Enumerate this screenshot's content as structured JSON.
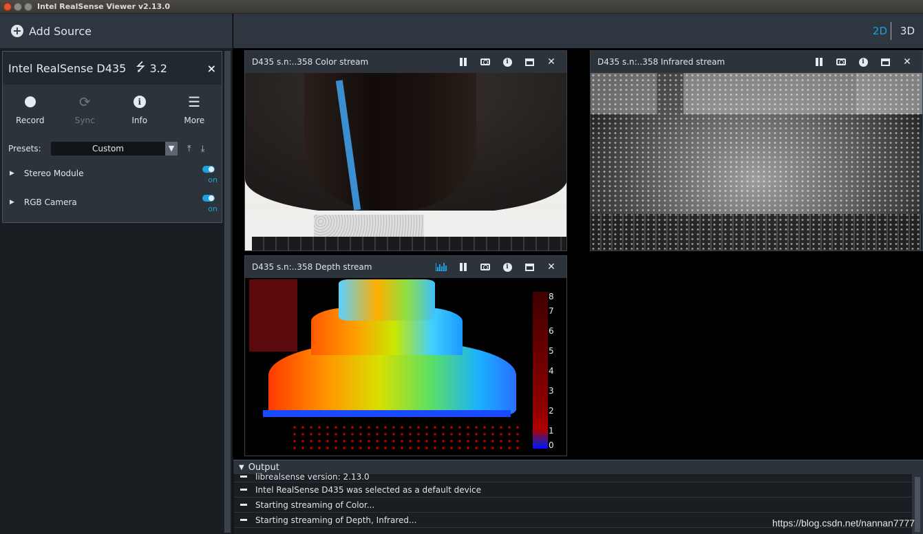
{
  "window": {
    "title": "Intel RealSense Viewer v2.13.0"
  },
  "left": {
    "add_source": "Add Source",
    "device": {
      "name": "Intel RealSense D435",
      "usb_icon": "usb-icon",
      "usb_version": "3.2",
      "close": "×",
      "toolbar": [
        {
          "label": "Record",
          "icon": "record-icon",
          "enabled": true
        },
        {
          "label": "Sync",
          "icon": "sync-icon",
          "enabled": false
        },
        {
          "label": "Info",
          "icon": "info-icon",
          "enabled": true
        },
        {
          "label": "More",
          "icon": "hamburger-icon",
          "enabled": true
        }
      ],
      "presets_label": "Presets:",
      "preset_value": "Custom",
      "sensors": [
        {
          "name": "Stereo Module",
          "state": "on"
        },
        {
          "name": "RGB Camera",
          "state": "on"
        }
      ]
    }
  },
  "view_modes": {
    "mode_2d": "2D",
    "mode_3d": "3D",
    "active": "2D"
  },
  "streams": {
    "color": {
      "title": "D435 s.n:..358 Color stream"
    },
    "infrared": {
      "title": "D435 s.n:..358 Infrared stream"
    },
    "depth": {
      "title": "D435 s.n:..358 Depth stream",
      "scale_ticks": [
        "8",
        "7",
        "6",
        "5",
        "4",
        "3",
        "2",
        "1",
        "0"
      ]
    }
  },
  "output": {
    "label": "Output",
    "lines": [
      "librealsense version: 2.13.0",
      "Intel RealSense D435 was selected as a default device",
      "Starting streaming of Color...",
      "Starting streaming of Depth, Infrared..."
    ]
  },
  "watermark": "https://blog.csdn.net/nannan7777",
  "colors": {
    "accent": "#1ea1e0",
    "panel": "#2c333b",
    "header": "#2e3640"
  }
}
